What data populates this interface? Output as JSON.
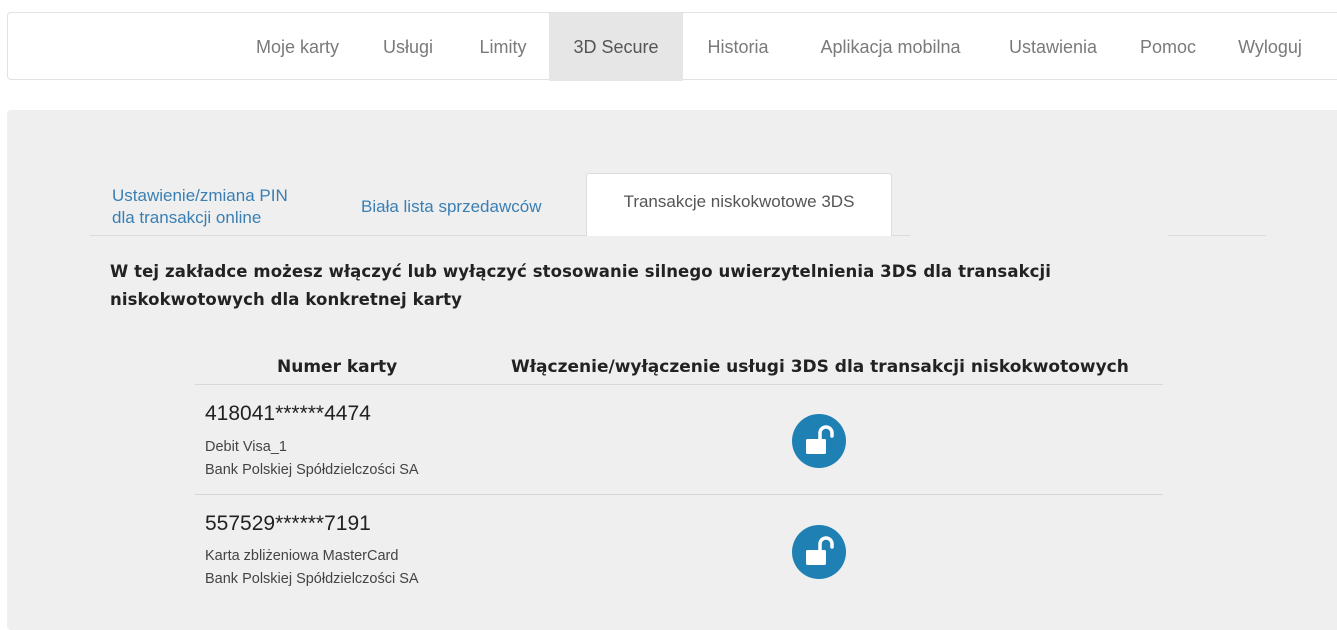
{
  "nav": {
    "items": [
      "Moje karty",
      "Usługi",
      "Limity",
      "3D Secure",
      "Historia",
      "Aplikacja mobilna",
      "Ustawienia",
      "Pomoc",
      "Wyloguj"
    ],
    "active": "3D Secure"
  },
  "tabs": [
    {
      "line1": "Ustawienie/zmiana PIN",
      "line2": "dla transakcji online"
    },
    {
      "line1": "Biała lista sprzedawców"
    },
    {
      "line1": "Transakcje niskokwotowe 3DS",
      "active": true
    }
  ],
  "description": {
    "line1": "W tej zakładce możesz włączyć lub wyłączyć stosowanie silnego uwierzytelnienia 3DS dla transakcji",
    "line2": "niskokwotowych dla konkretnej karty"
  },
  "table": {
    "headers": [
      "Numer karty",
      "Włączenie/wyłączenie usługi 3DS dla transakcji niskokwotowych"
    ],
    "rows": [
      {
        "number": "418041******4474",
        "name": "Debit Visa_1",
        "bank": "Bank Polskiej Spółdzielczości SA",
        "toggle_icon": "unlock-icon"
      },
      {
        "number": "557529******7191",
        "name": "Karta zbliżeniowa MasterCard",
        "bank": "Bank Polskiej Spółdzielczości SA",
        "toggle_icon": "unlock-icon"
      }
    ]
  },
  "colors": {
    "accent": "#1f80b3",
    "link": "#3a7fb3",
    "panel": "#efefef"
  }
}
